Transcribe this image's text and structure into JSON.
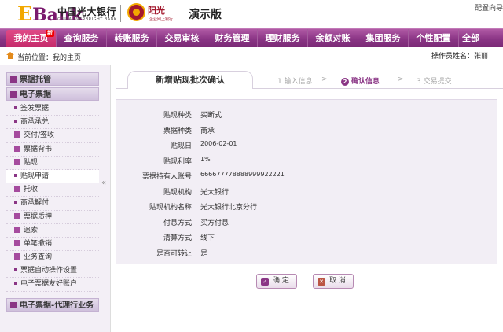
{
  "header": {
    "logo_e": "E",
    "logo_bank": "Bank",
    "bank_name_cn": "中国光大银行",
    "bank_name_en": "CHINA EVERBRIGHT BANK",
    "brand_name": "阳光",
    "brand_sub": "企业网上银行",
    "demo_label": "演示版",
    "top_link": "配置向导"
  },
  "nav": {
    "items": [
      {
        "label": "我的主页",
        "badge": "新"
      },
      {
        "label": "查询服务"
      },
      {
        "label": "转账服务"
      },
      {
        "label": "交易审核"
      },
      {
        "label": "财务管理"
      },
      {
        "label": "理财服务"
      },
      {
        "label": "余额对账"
      },
      {
        "label": "集团服务"
      },
      {
        "label": "个性配置"
      },
      {
        "label": "全部"
      }
    ]
  },
  "breadcrumb": {
    "text": "当前位置：我的主页",
    "operator": "操作员姓名：张丽"
  },
  "sidebar": {
    "sections": [
      {
        "title": "票据托管"
      },
      {
        "title": "电子票据"
      }
    ],
    "items": [
      {
        "label": "签发票据",
        "marker": "bullet"
      },
      {
        "label": "商承承兑",
        "marker": "bullet"
      },
      {
        "label": "交付/签收",
        "marker": "icon"
      },
      {
        "label": "票据背书",
        "marker": "icon"
      },
      {
        "label": "贴现",
        "marker": "icon"
      },
      {
        "label": "贴现申请",
        "marker": "bullet",
        "selected": true
      },
      {
        "label": "托收",
        "marker": "icon"
      },
      {
        "label": "商承解付",
        "marker": "bullet"
      },
      {
        "label": "票据质押",
        "marker": "icon"
      },
      {
        "label": "追索",
        "marker": "icon"
      },
      {
        "label": "单笔撤销",
        "marker": "icon"
      },
      {
        "label": "业务查询",
        "marker": "icon"
      },
      {
        "label": "票据自动操作设置",
        "marker": "bullet"
      },
      {
        "label": "电子票据友好账户",
        "marker": "bullet"
      }
    ],
    "bottom_section": "电子票据-代理行业务",
    "collapse_glyph": "«"
  },
  "main": {
    "tab_title": "新增贴现批次确认",
    "steps": [
      {
        "num": "1",
        "label": "输入信息"
      },
      {
        "num": "2",
        "label": "确认信息"
      },
      {
        "num": "3",
        "label": "交易提交"
      }
    ],
    "step_separator": ">",
    "fields": [
      {
        "label": "贴现种类:",
        "value": "买断式"
      },
      {
        "label": "票据种类:",
        "value": "商承"
      },
      {
        "label": "贴现日:",
        "value": "2006-02-01"
      },
      {
        "label": "贴现利率:",
        "value": "1%"
      },
      {
        "label": "票据持有人账号:",
        "value": "666677778888999922221"
      },
      {
        "label": "贴现机构:",
        "value": "光大银行"
      },
      {
        "label": "贴现机构名称:",
        "value": "光大银行北京分行"
      },
      {
        "label": "付息方式:",
        "value": "买方付息"
      },
      {
        "label": "清算方式:",
        "value": "线下"
      },
      {
        "label": "是否可转让:",
        "value": "是"
      }
    ],
    "buttons": {
      "confirm": "确 定",
      "cancel": "取 消"
    }
  }
}
